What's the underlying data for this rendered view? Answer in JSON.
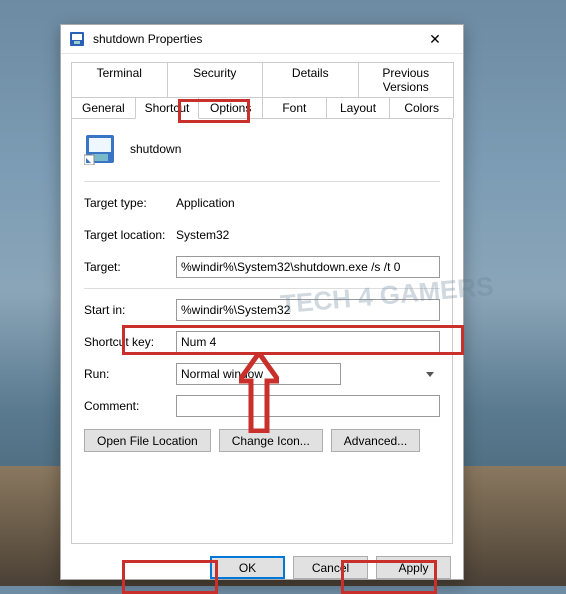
{
  "window": {
    "title": "shutdown Properties",
    "close_label": "✕"
  },
  "tabs_row1": [
    {
      "label": "Terminal"
    },
    {
      "label": "Security"
    },
    {
      "label": "Details"
    },
    {
      "label": "Previous Versions"
    }
  ],
  "tabs_row2": [
    {
      "label": "General"
    },
    {
      "label": "Shortcut"
    },
    {
      "label": "Options"
    },
    {
      "label": "Font"
    },
    {
      "label": "Layout"
    },
    {
      "label": "Colors"
    }
  ],
  "shortcut": {
    "name": "shutdown",
    "target_type_label": "Target type:",
    "target_type_value": "Application",
    "target_location_label": "Target location:",
    "target_location_value": "System32",
    "target_label": "Target:",
    "target_value": "%windir%\\System32\\shutdown.exe /s /t 0",
    "start_in_label": "Start in:",
    "start_in_value": "%windir%\\System32",
    "shortcut_key_label": "Shortcut key:",
    "shortcut_key_value": "Num 4",
    "run_label": "Run:",
    "run_value": "Normal window",
    "comment_label": "Comment:",
    "comment_value": ""
  },
  "buttons": {
    "open_file_location": "Open File Location",
    "change_icon": "Change Icon...",
    "advanced": "Advanced...",
    "ok": "OK",
    "cancel": "Cancel",
    "apply": "Apply"
  },
  "watermark": "TECH 4 GAMERS"
}
